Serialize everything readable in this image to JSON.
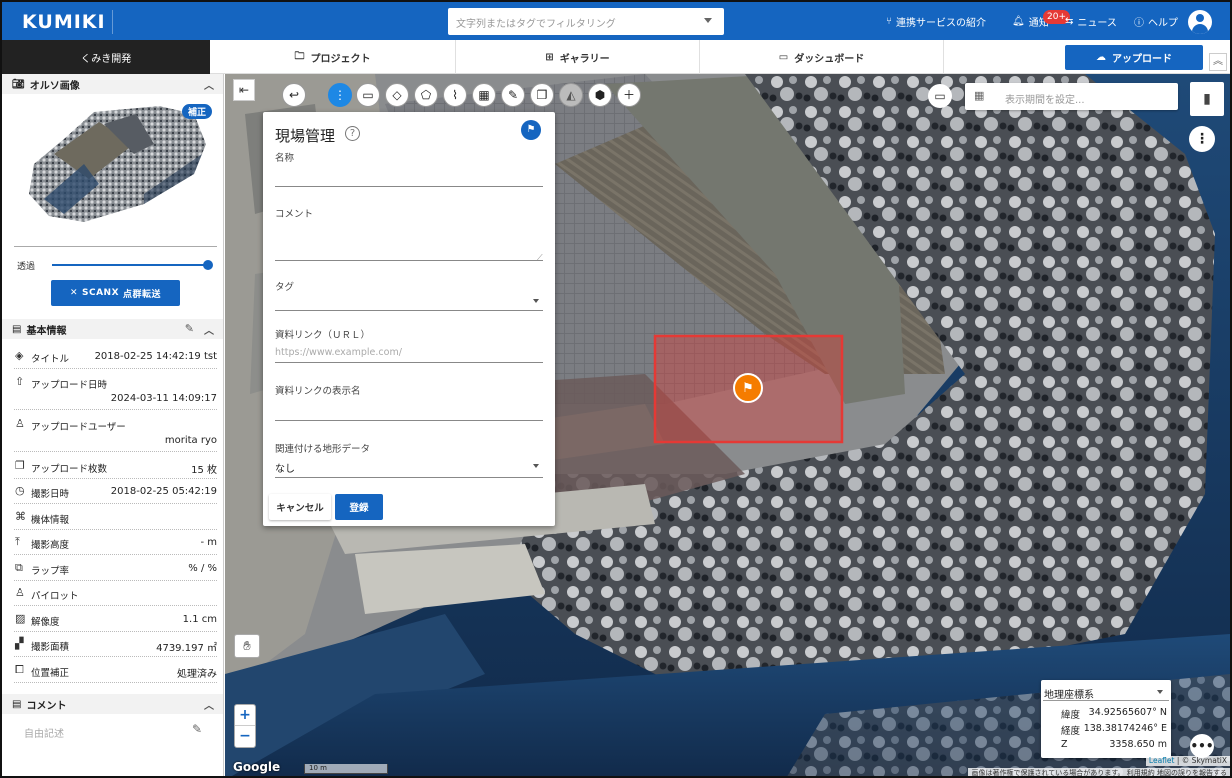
{
  "header": {
    "logo": "KUMIKI",
    "search_placeholder": "文字列またはタグでフィルタリング",
    "links": {
      "integrations": "連携サービスの紹介",
      "notifications": "通知",
      "notifications_badge": "20+",
      "news": "ニュース",
      "help": "ヘルプ"
    }
  },
  "nav": {
    "project_name": "くみき開発",
    "tabs": [
      "プロジェクト",
      "ギャラリー",
      "ダッシュボード"
    ],
    "upload_label": "アップロード"
  },
  "sidebar": {
    "ortho": {
      "title": "オルソ画像",
      "badge": "補正",
      "opacity_label": "透過",
      "opacity_value": 1.0,
      "scanx_label": "点群転送",
      "scanx_logo": "SCANX"
    },
    "basic": {
      "title": "基本情報",
      "rows": [
        {
          "icon": "layers-icon",
          "label": "タイトル",
          "value": "2018-02-25 14:42:19 tst"
        },
        {
          "icon": "upload-icon",
          "label": "アップロード日時",
          "value": "2024-03-11 14:09:17"
        },
        {
          "icon": "person-icon",
          "label": "アップロードユーザー",
          "value": "morita ryo"
        },
        {
          "icon": "images-icon",
          "label": "アップロード枚数",
          "value": "15 枚"
        },
        {
          "icon": "clock-icon",
          "label": "撮影日時",
          "value": "2018-02-25 05:42:19"
        },
        {
          "icon": "drone-icon",
          "label": "機体情報",
          "value": ""
        },
        {
          "icon": "altitude-icon",
          "label": "撮影高度",
          "value": "- m"
        },
        {
          "icon": "overlap-icon",
          "label": "ラップ率",
          "value": "% / %"
        },
        {
          "icon": "pilot-icon",
          "label": "パイロット",
          "value": ""
        },
        {
          "icon": "resolution-icon",
          "label": "解像度",
          "value": "1.1 cm"
        },
        {
          "icon": "area-icon",
          "label": "撮影面積",
          "value": "4739.197 ㎡"
        },
        {
          "icon": "correction-icon",
          "label": "位置補正",
          "value": "処理済み"
        }
      ]
    },
    "comment": {
      "title": "コメント",
      "placeholder": "自由記述"
    }
  },
  "map": {
    "period_placeholder": "表示期間を設定...",
    "zoom_in": "+",
    "zoom_out": "−",
    "google_label": "Google",
    "scale_label": "10 m",
    "coord": {
      "system": "地理座標系",
      "lat_label": "緯度",
      "lat": "34.92565607° N",
      "lon_label": "経度",
      "lon": "138.38174246° E",
      "z_label": "Z",
      "z": "3358.650 m"
    },
    "attribution_leaflet": "Leaflet",
    "attribution_rest": " | © SkymatiX",
    "attribution_line2": "画像は著作権で保護されている場合があります。 利用規約   地図の誤りを報告する"
  },
  "form": {
    "title": "現場管理",
    "fields": {
      "name_label": "名称",
      "comment_label": "コメント",
      "tag_label": "タグ",
      "link_label": "資料リンク（ＵＲＬ）",
      "link_placeholder": "https://www.example.com/",
      "link_name_label": "資料リンクの表示名",
      "terrain_label": "関連付ける地形データ",
      "terrain_value": "なし"
    },
    "cancel_label": "キャンセル",
    "submit_label": "登録"
  },
  "colors": {
    "primary": "#1565c0",
    "marker": "#f57c00",
    "selection": "#e53935"
  }
}
